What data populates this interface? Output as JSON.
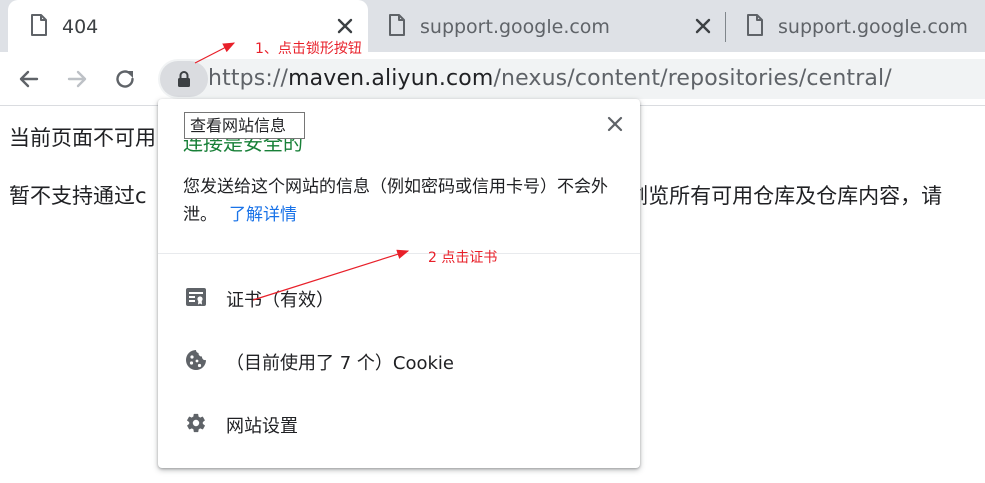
{
  "tabs": [
    {
      "title": "404"
    },
    {
      "title": "support.google.com"
    },
    {
      "title": "support.google.com"
    }
  ],
  "toolbar": {
    "url_scheme": "https://",
    "url_host": "maven.aliyun.com",
    "url_path": "/nexus/content/repositories/central/"
  },
  "page": {
    "title": "当前页面不可用",
    "desc": "暂不支持通过c                                                                        浏览所有可用仓库及仓库内容，请"
  },
  "popup": {
    "heading": "连接是安全的",
    "description": "您发送给这个网站的信息（例如密码或信用卡号）不会外泄。",
    "learn_more": "了解详情",
    "items": [
      {
        "label": "证书（有效）",
        "icon": "certificate-icon"
      },
      {
        "label": "（目前使用了 7 个）Cookie",
        "icon": "cookie-icon"
      },
      {
        "label": "网站设置",
        "icon": "gear-icon"
      }
    ]
  },
  "tooltip": "查看网站信息",
  "annotations": {
    "step1": "1、点击锁形按钮",
    "step2": "2 点击证书",
    "color": "#e8202a"
  },
  "colors": {
    "tabstrip": "#dee1e6",
    "secure_green": "#188038",
    "link_blue": "#1a73e8"
  }
}
